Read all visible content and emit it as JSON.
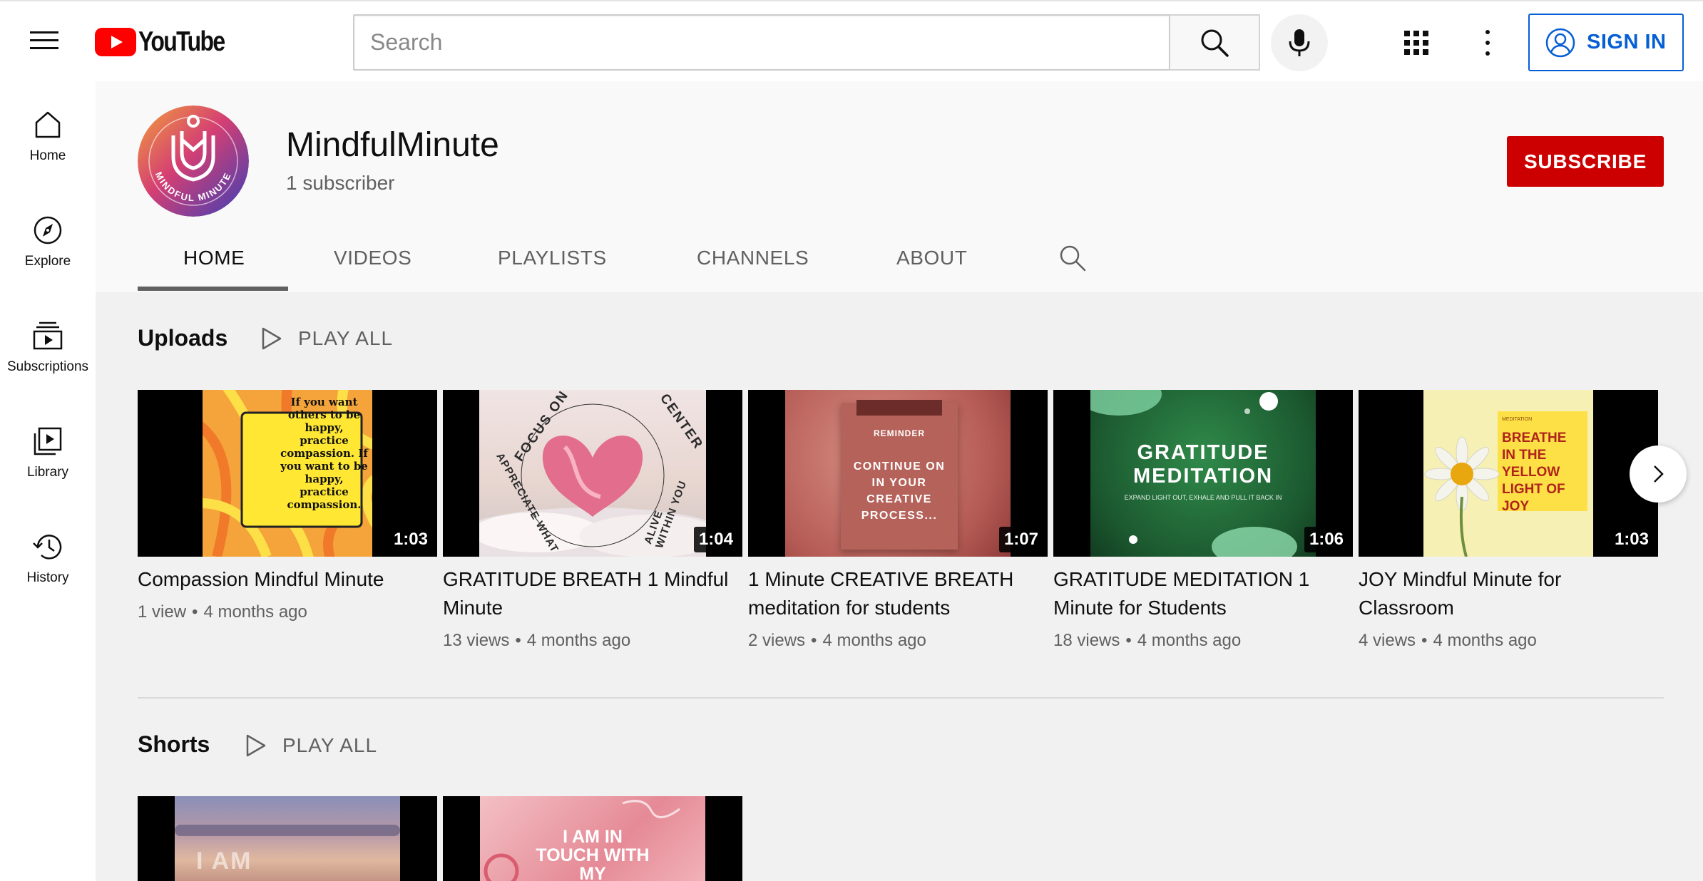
{
  "topbar": {
    "logo_text": "YouTube",
    "search_placeholder": "Search",
    "signin_label": "SIGN IN",
    "icons": [
      "menu-icon",
      "youtube-logo-icon",
      "search-icon",
      "microphone-icon",
      "apps-grid-icon",
      "more-vert-icon",
      "account-circle-icon"
    ]
  },
  "sidebar": {
    "items": [
      {
        "label": "Home",
        "icon": "home-icon"
      },
      {
        "label": "Explore",
        "icon": "compass-icon"
      },
      {
        "label": "Subscriptions",
        "icon": "subscriptions-icon"
      },
      {
        "label": "Library",
        "icon": "library-icon"
      },
      {
        "label": "History",
        "icon": "history-icon"
      }
    ]
  },
  "channel": {
    "name": "MindfulMinute",
    "subscribers": "1 subscriber",
    "avatar_text": "MINDFUL MINUTE",
    "subscribe_label": "SUBSCRIBE",
    "tabs": [
      "HOME",
      "VIDEOS",
      "PLAYLISTS",
      "CHANNELS",
      "ABOUT"
    ],
    "active_tab": "HOME"
  },
  "uploads": {
    "title": "Uploads",
    "play_all": "PLAY ALL",
    "videos": [
      {
        "title": "Compassion Mindful Minute",
        "views": "1 view",
        "age": "4 months ago",
        "duration": "1:03",
        "thumb_text": "If you want others to be happy, practice compassion. If you want to be happy, practice compassion."
      },
      {
        "title": "GRATITUDE BREATH 1 Mindful Minute",
        "views": "13 views",
        "age": "4 months ago",
        "duration": "1:04",
        "thumb_text_top": "FOCUS ON",
        "thumb_text_top2": "CENTER",
        "thumb_text_left": "APPRECIATE WHAT",
        "thumb_text_right": "ALIVE WITHIN YOU"
      },
      {
        "title": "1 Minute CREATIVE BREATH meditation for students",
        "views": "2 views",
        "age": "4 months ago",
        "duration": "1:07",
        "thumb_label": "REMINDER",
        "thumb_text": "CONTINUE ON IN YOUR CREATIVE PROCESS..."
      },
      {
        "title": "GRATITUDE MEDITATION 1 Minute for Students",
        "views": "18 views",
        "age": "4 months ago",
        "duration": "1:06",
        "thumb_heading": "GRATITUDE MEDITATION",
        "thumb_sub": "EXPAND LIGHT OUT, EXHALE AND PULL IT BACK IN"
      },
      {
        "title": "JOY Mindful Minute for Classroom",
        "views": "4 views",
        "age": "4 months ago",
        "duration": "1:03",
        "thumb_small": "MEDITATION",
        "thumb_text": "BREATHE IN THE YELLOW LIGHT OF JOY"
      }
    ]
  },
  "shorts": {
    "title": "Shorts",
    "play_all": "PLAY ALL",
    "items": [
      {
        "thumb_text": "I AM"
      },
      {
        "thumb_text": "I AM IN TOUCH WITH MY CREATIVE"
      }
    ]
  },
  "colors": {
    "brand_red": "#ff0000",
    "subscribe_red": "#cc0000",
    "signin_blue": "#065fd4"
  }
}
